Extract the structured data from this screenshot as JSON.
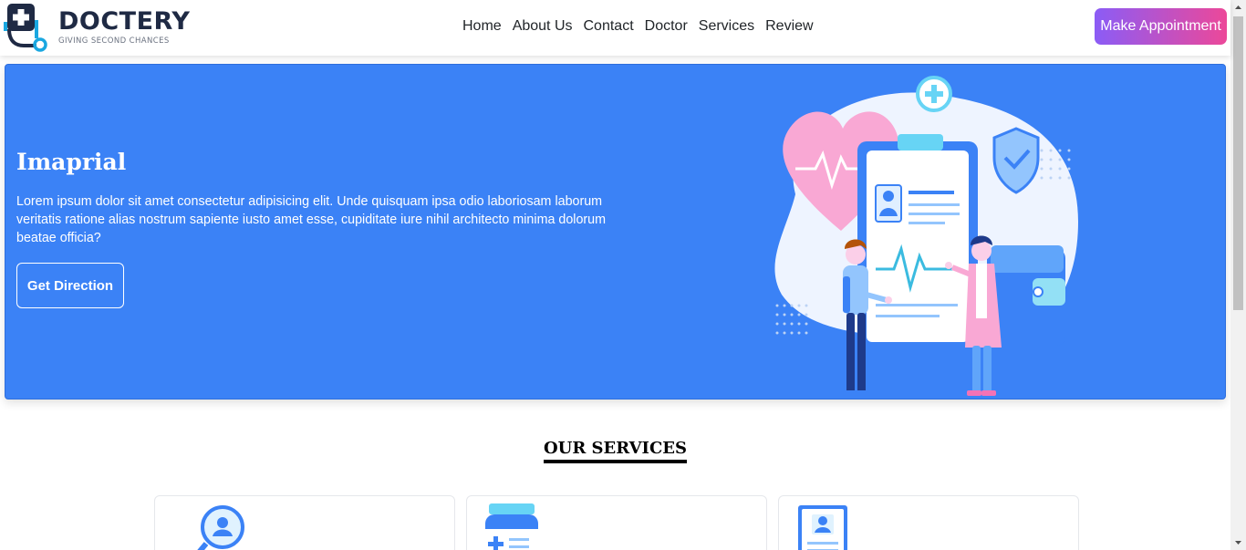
{
  "brand": {
    "name": "DOCTERY",
    "tagline": "GIVING SECOND CHANCES",
    "logo_icon": "stethoscope-cross-icon",
    "colors": {
      "dark": "#1f2a44",
      "accent": "#1aa7e0"
    }
  },
  "nav": {
    "links": [
      "Home",
      "About Us",
      "Contact",
      "Doctor",
      "Services",
      "Review"
    ],
    "cta_label": "Make Appointment",
    "cta_gradient": [
      "#8b5cf6",
      "#ec4899"
    ]
  },
  "hero": {
    "title": "Imaprial",
    "text": "Lorem ipsum dolor sit amet consectetur adipisicing elit. Unde quisquam ipsa odio laboriosam laborum veritatis ratione alias nostrum sapiente iusto amet esse, cupiditate iure nihil architecto minima dolorum beatae officia?",
    "button_label": "Get Direction",
    "background": "#3b82f6",
    "illustration": "medical-clipboard-doctors-illustration"
  },
  "services": {
    "title": "OUR SERVICES",
    "cards": [
      {
        "icon": "search-user-icon"
      },
      {
        "icon": "medicine-bottle-icon"
      },
      {
        "icon": "medical-id-card-icon"
      }
    ]
  }
}
